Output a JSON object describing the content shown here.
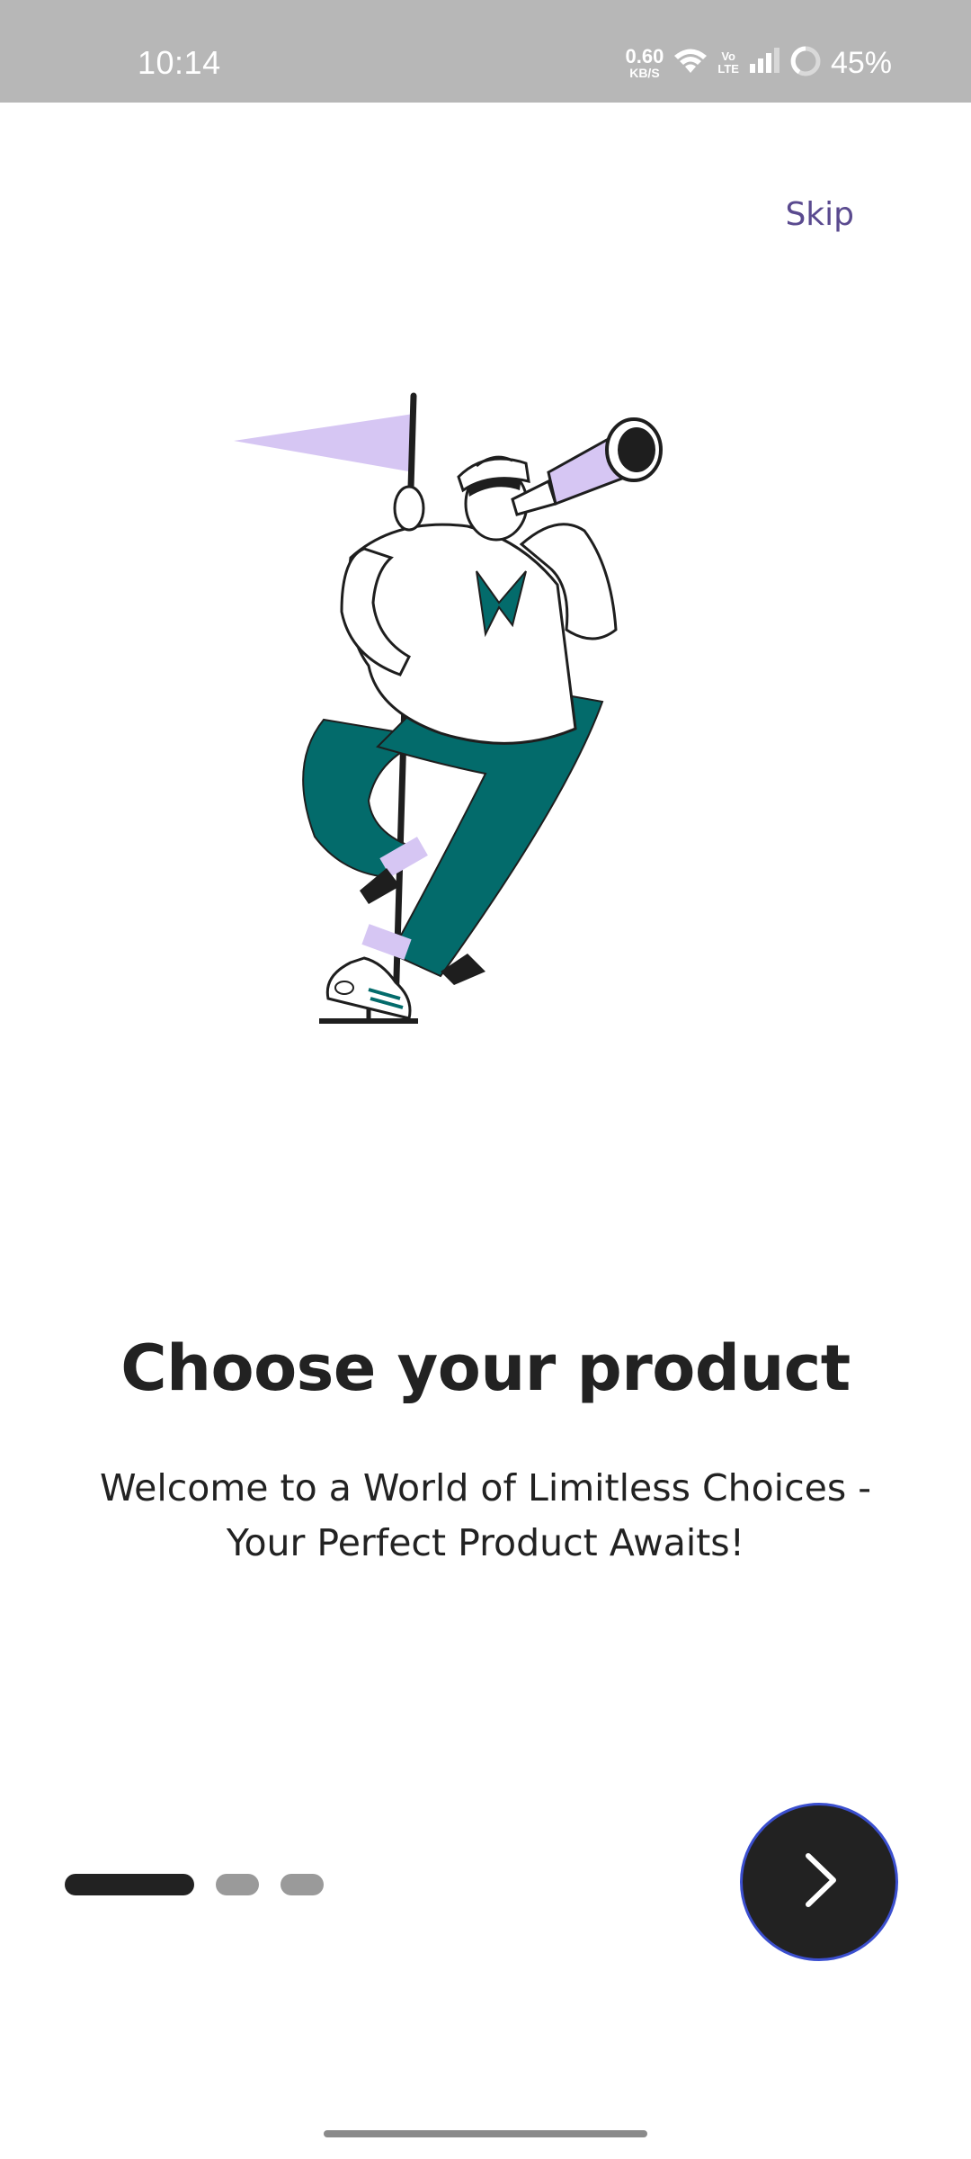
{
  "status_bar": {
    "time": "10:14",
    "net_speed_value": "0.60",
    "net_speed_unit": "KB/S",
    "volte_top": "Vo",
    "volte_bottom": "LTE",
    "battery": "45%",
    "background": "#b7b7b7"
  },
  "onboarding": {
    "skip_label": "Skip",
    "title": "Choose your product",
    "subtitle_line1": "Welcome to a World of Limitless Choices -",
    "subtitle_line2": "Your Perfect Product Awaits!",
    "page_count": 3,
    "current_page": 1
  },
  "colors": {
    "accent_purple": "#5a4a8f",
    "illustration_teal": "#036b6b",
    "illustration_lavender": "#d6c6f3",
    "button_dark": "#222222",
    "button_border": "#3b4fcf"
  },
  "icons": {
    "next": "chevron-right-icon",
    "wifi": "wifi-icon",
    "signal": "signal-icon",
    "battery": "battery-ring-icon"
  }
}
